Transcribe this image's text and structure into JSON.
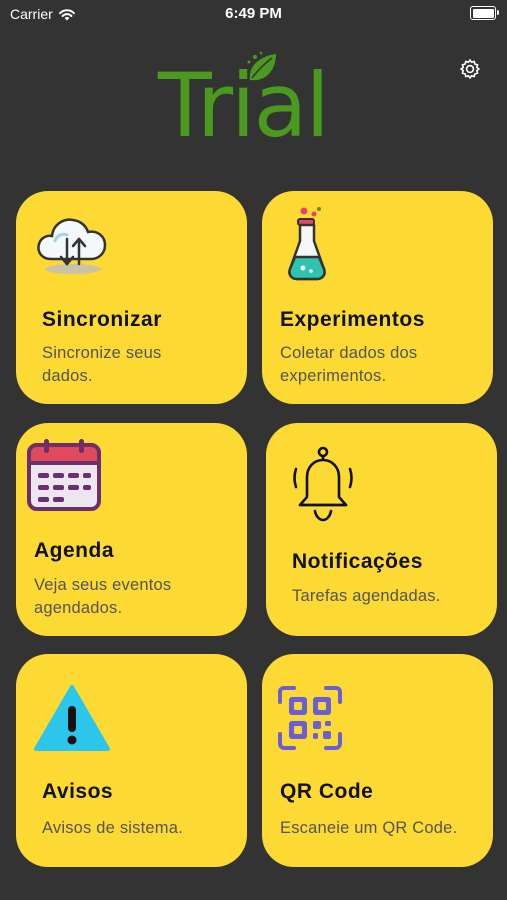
{
  "status_bar": {
    "carrier": "Carrier",
    "time": "6:49 PM"
  },
  "app": {
    "logo_text": "Trial",
    "brand_color": "#4a9a1f",
    "card_color": "#fdd933",
    "background": "#333333"
  },
  "cards": [
    {
      "icon": "cloud-sync-icon",
      "title": "Sincronizar",
      "description": "Sincronize seus dados."
    },
    {
      "icon": "flask-icon",
      "title": "Experimentos",
      "description": "Coletar dados dos experimentos."
    },
    {
      "icon": "calendar-icon",
      "title": "Agenda",
      "description": "Veja seus eventos agendados."
    },
    {
      "icon": "bell-icon",
      "title": "Notificações",
      "description": "Tarefas agendadas."
    },
    {
      "icon": "warning-icon",
      "title": "Avisos",
      "description": "Avisos de sistema."
    },
    {
      "icon": "qr-code-icon",
      "title": "QR Code",
      "description": "Escaneie um QR Code."
    }
  ]
}
